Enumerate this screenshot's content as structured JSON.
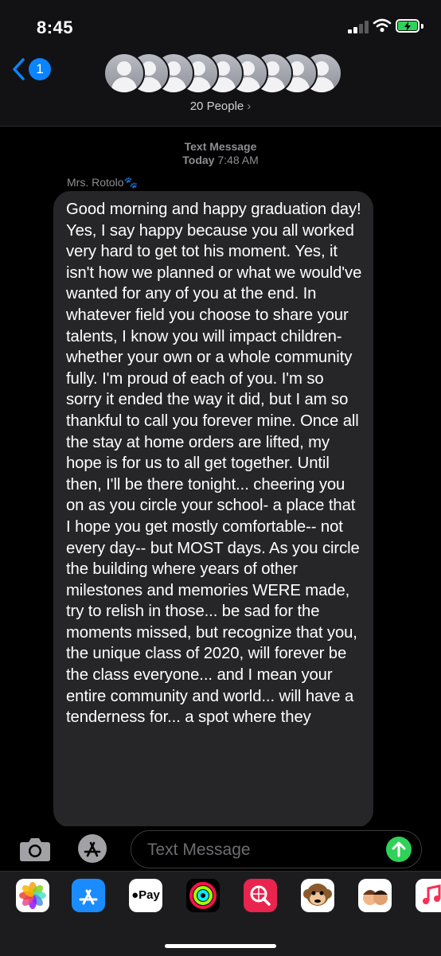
{
  "status_bar": {
    "time": "8:45"
  },
  "header": {
    "back_badge": "1",
    "group_label": "20 People",
    "group_chevron": "›",
    "avatar_count": 9
  },
  "conversation": {
    "stamp_type": "Text Message",
    "stamp_day": "Today",
    "stamp_time": "7:48 AM",
    "sender": "Mrs. Rotolo🐾",
    "message": "Good morning and happy graduation day! Yes, I say happy because you all worked very hard to get tot his moment. Yes, it isn't how we planned or what we would've wanted for any of you at the end. In whatever field you choose to share your talents, I know you will impact children- whether your own or a whole community fully. I'm proud of each of you. I'm so sorry it ended the way it did, but I am so thankful to call you forever mine. Once all the stay at home orders are lifted, my hope is for us to all get together. Until then, I'll be there tonight... cheering you on as you circle your school- a place that I hope you get mostly comfortable-- not every day-- but MOST days. As you circle the building where years of other milestones and memories WERE made, try to relish in those... be sad for the moments missed, but recognize that you, the unique class of 2020, will forever be the class everyone... and I mean your entire community and world... will have a tenderness for... a spot where they"
  },
  "composer": {
    "placeholder": "Text Message"
  },
  "app_drawer": {
    "apps": [
      "photos-icon",
      "app-store-icon",
      "apple-pay-icon",
      "activity-icon",
      "images-search-icon",
      "monkey-memoji-icon",
      "memoji-icon",
      "music-icon"
    ],
    "pay_label": "Pay"
  },
  "colors": {
    "accent_blue": "#0a84ff",
    "send_green": "#30d158",
    "bubble_gray": "#262628",
    "header_bg": "#121214"
  }
}
